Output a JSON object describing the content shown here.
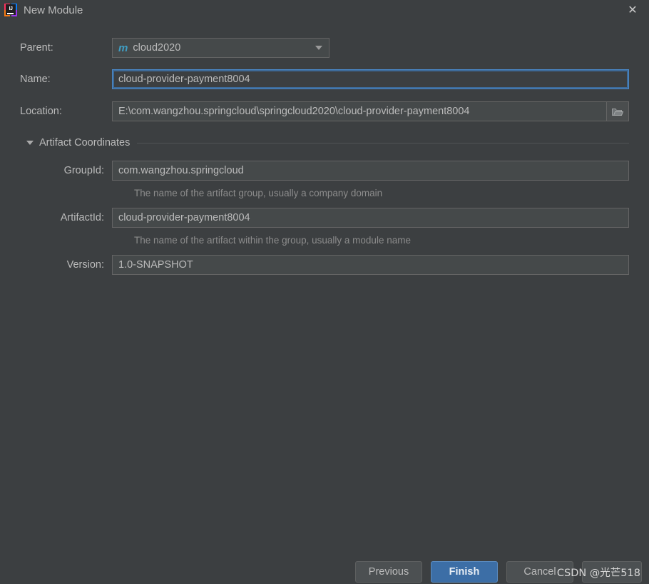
{
  "window": {
    "title": "New Module",
    "app_icon": "intellij-idea-logo",
    "close_icon": "✕"
  },
  "form": {
    "parent": {
      "label": "Parent:",
      "value": "cloud2020",
      "icon": "maven-module-icon",
      "icon_glyph": "m",
      "dropdown_icon": "chevron-down-icon"
    },
    "name": {
      "label": "Name:",
      "value": "cloud-provider-payment8004",
      "focused": true
    },
    "location": {
      "label": "Location:",
      "value": "E:\\com.wangzhou.springcloud\\springcloud2020\\cloud-provider-payment8004",
      "browse_icon": "folder-icon"
    }
  },
  "artifact_section": {
    "title": "Artifact Coordinates",
    "expand_icon": "triangle-down-icon",
    "expanded": true,
    "group_id": {
      "label": "GroupId:",
      "value": "com.wangzhou.springcloud",
      "hint": "The name of the artifact group, usually a company domain"
    },
    "artifact_id": {
      "label": "ArtifactId:",
      "value": "cloud-provider-payment8004",
      "hint": "The name of the artifact within the group, usually a module name"
    },
    "version": {
      "label": "Version:",
      "value": "1.0-SNAPSHOT"
    }
  },
  "footer": {
    "previous_label": "Previous",
    "finish_label": "Finish",
    "cancel_label": "Cancel",
    "help_label": ""
  },
  "watermark": {
    "text": "CSDN @光芒518"
  },
  "colors": {
    "background": "#3c3f41",
    "field_background": "#45494a",
    "field_border": "#646464",
    "focus_border": "#4a88c7",
    "default_button": "#3c6ea6",
    "text": "#bbbbbb",
    "hint_text": "#8c8c8c",
    "maven_icon": "#3f9ec4"
  }
}
